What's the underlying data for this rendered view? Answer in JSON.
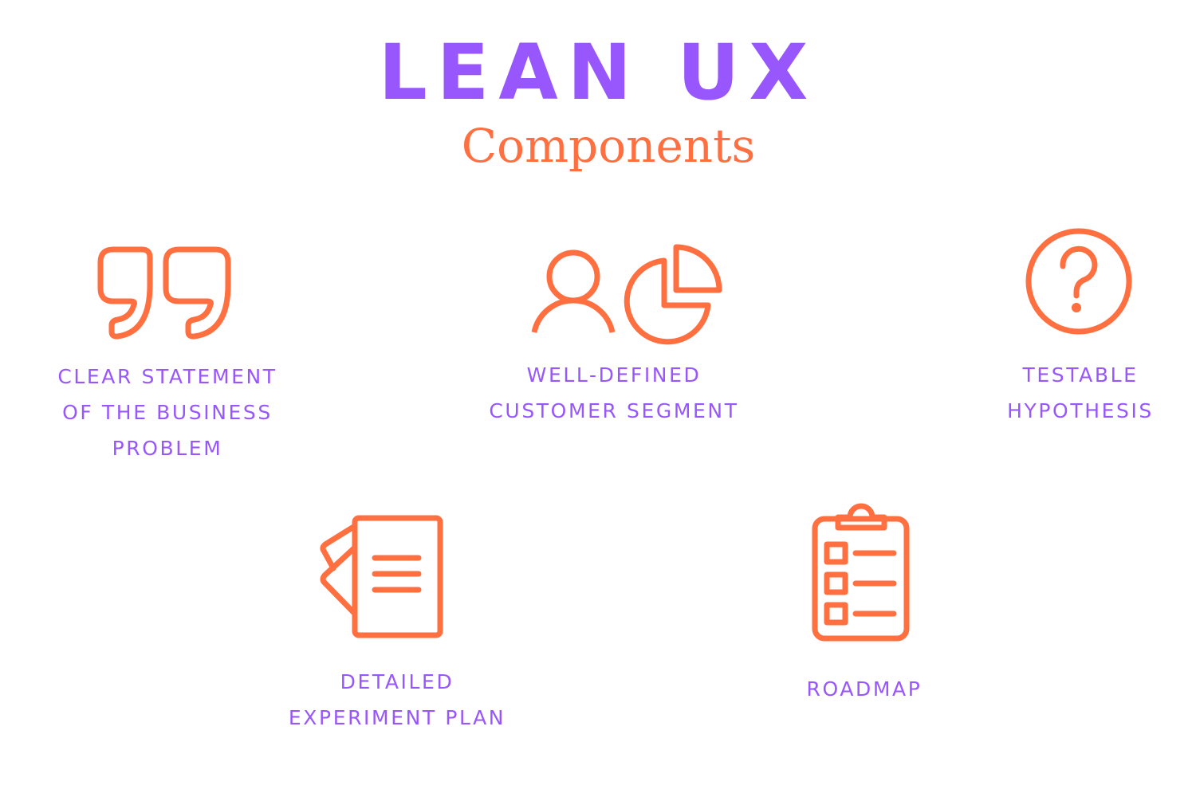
{
  "header": {
    "title": "LEAN UX",
    "subtitle": "Components"
  },
  "colors": {
    "title": "#9857fd",
    "accent": "#ff6f40",
    "label": "#9857fd"
  },
  "components": [
    {
      "icon": "quote-icon",
      "lines": [
        "CLEAR STATEMENT",
        "OF THE BUSINESS",
        "PROBLEM"
      ]
    },
    {
      "icon": "user-pie-chart-icon",
      "lines": [
        "WELL-DEFINED",
        "CUSTOMER SEGMENT"
      ]
    },
    {
      "icon": "question-circle-icon",
      "lines": [
        "TESTABLE",
        "HYPOTHESIS"
      ]
    },
    {
      "icon": "document-icon",
      "lines": [
        "DETAILED",
        "EXPERIMENT PLAN"
      ]
    },
    {
      "icon": "clipboard-checklist-icon",
      "lines": [
        "ROADMAP"
      ]
    }
  ]
}
